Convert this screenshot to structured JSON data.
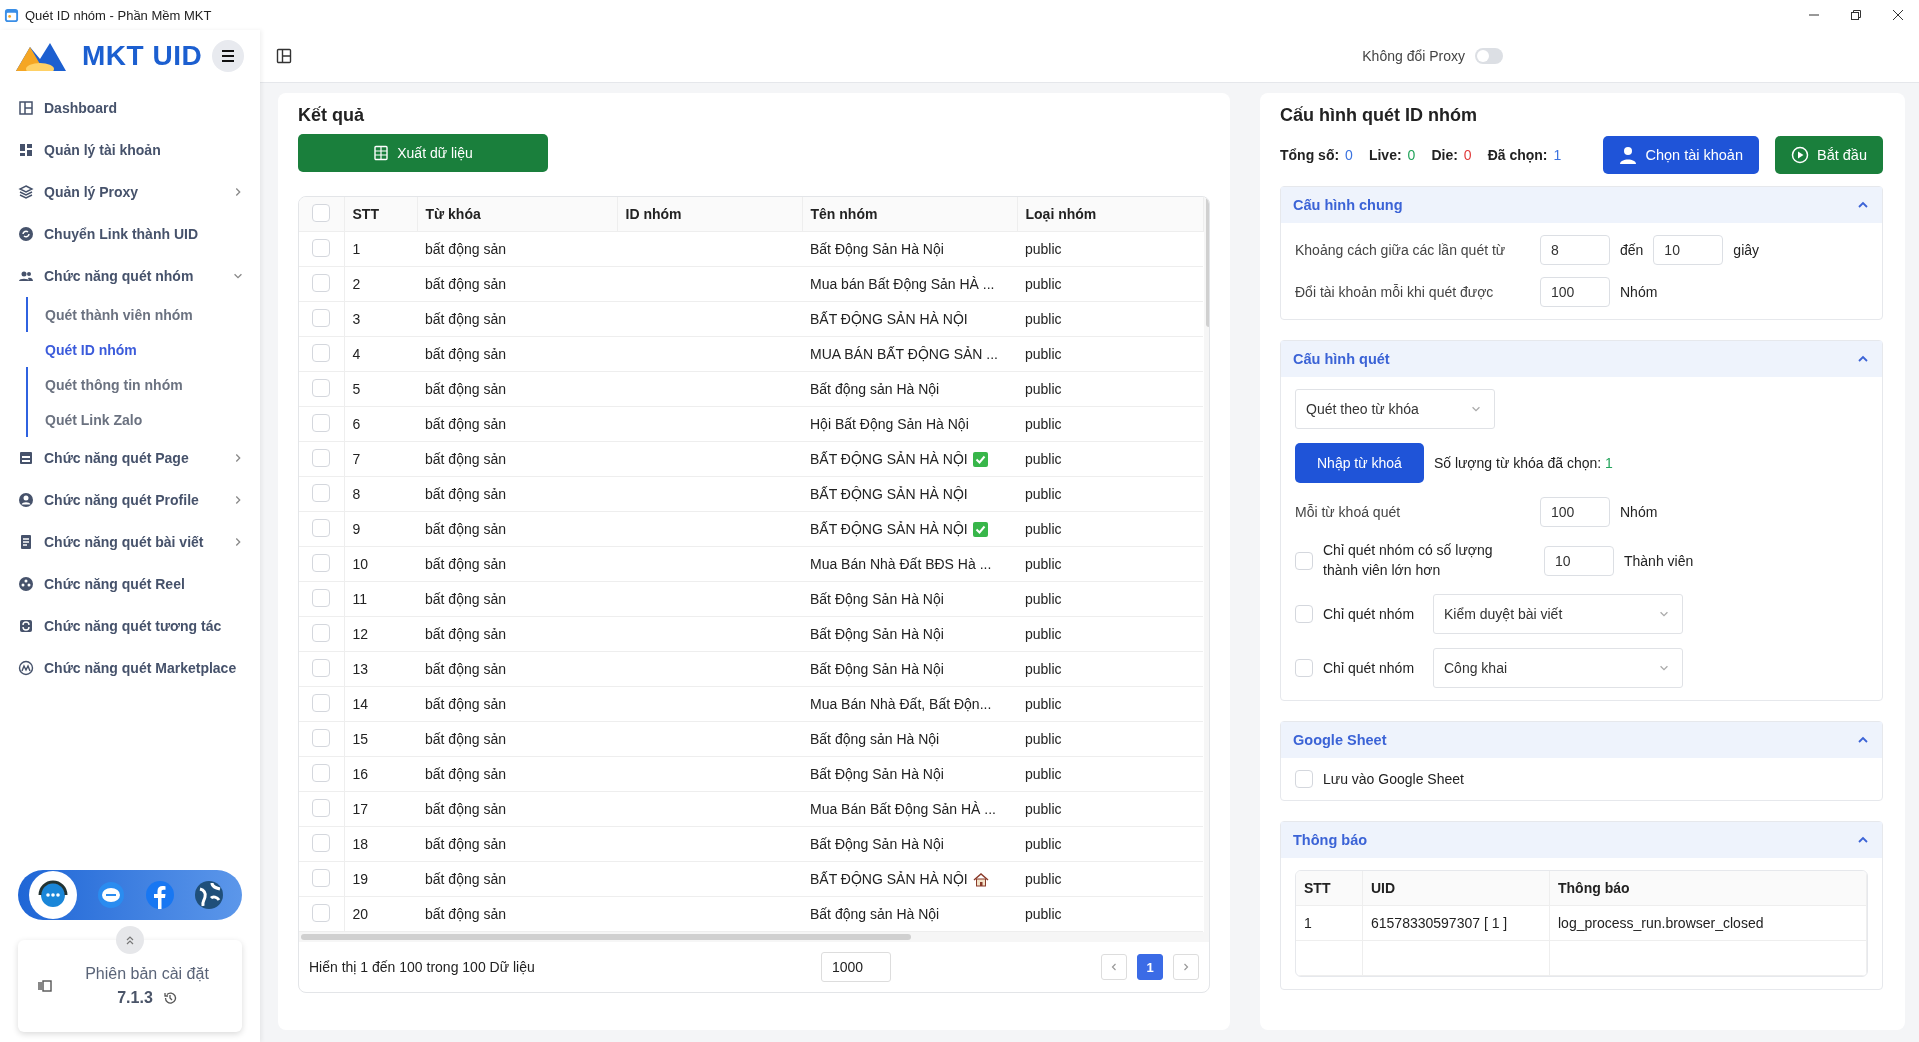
{
  "window": {
    "title": "Quét ID nhóm - Phần Mềm MKT"
  },
  "sidebar": {
    "logo": "MKT UID",
    "items": [
      {
        "kind": "link",
        "label": "Dashboard"
      },
      {
        "kind": "link",
        "label": "Quản lý tài khoản"
      },
      {
        "kind": "group",
        "label": "Quản lý Proxy",
        "expanded": false
      },
      {
        "kind": "link",
        "label": "Chuyển Link thành UID"
      },
      {
        "kind": "group",
        "label": "Chức năng quét nhóm",
        "expanded": true,
        "children": [
          {
            "label": "Quét thành viên nhóm",
            "selected": false
          },
          {
            "label": "Quét ID nhóm",
            "selected": true
          },
          {
            "label": "Quét thông tin nhóm",
            "selected": false
          },
          {
            "label": "Quét Link Zalo",
            "selected": false
          }
        ]
      },
      {
        "kind": "group",
        "label": "Chức năng quét Page",
        "expanded": false
      },
      {
        "kind": "group",
        "label": "Chức năng quét Profile",
        "expanded": false
      },
      {
        "kind": "group",
        "label": "Chức năng quét bài viết",
        "expanded": false
      },
      {
        "kind": "link",
        "label": "Chức năng quét Reel"
      },
      {
        "kind": "link",
        "label": "Chức năng quét tương tác"
      },
      {
        "kind": "link",
        "label": "Chức năng quét Marketplace"
      }
    ],
    "version": {
      "label": "Phiên bản cài đặt",
      "number": "7.1.3"
    }
  },
  "header": {
    "proxy_toggle": {
      "label": "Không đổi Proxy",
      "on": false
    }
  },
  "results": {
    "title": "Kết quả",
    "export_button": "Xuất dữ liệu",
    "table": {
      "all_checked": false,
      "columns": [
        "STT",
        "Từ khóa",
        "ID nhóm",
        "Tên nhóm",
        "Loại nhóm"
      ],
      "rows": [
        {
          "checked": false,
          "stt": "1",
          "keyword": "bất động sản",
          "name": "Bất Động Sản Hà Nội",
          "type": "public"
        },
        {
          "checked": false,
          "stt": "2",
          "keyword": "bất động sản",
          "name": "Mua bán Bất Động Sản HÀ ...",
          "type": "public"
        },
        {
          "checked": false,
          "stt": "3",
          "keyword": "bất động sản",
          "name": "BẤT ĐỘNG SẢN HÀ NỘI",
          "type": "public"
        },
        {
          "checked": false,
          "stt": "4",
          "keyword": "bất động sản",
          "name": "MUA BÁN BẤT ĐỘNG SẢN ...",
          "type": "public"
        },
        {
          "checked": false,
          "stt": "5",
          "keyword": "bất động sản",
          "name": "Bất động sản Hà Nội",
          "type": "public"
        },
        {
          "checked": false,
          "stt": "6",
          "keyword": "bất động sản",
          "name": "Hội Bất Động Sản Hà Nội",
          "type": "public"
        },
        {
          "checked": false,
          "stt": "7",
          "keyword": "bất động sản",
          "name": "BẤT ĐỘNG SẢN HÀ NỘI",
          "kind": "check",
          "type": "public"
        },
        {
          "checked": false,
          "stt": "8",
          "keyword": "bất động sản",
          "name": "BẤT ĐỘNG SẢN HÀ NỘI",
          "type": "public"
        },
        {
          "checked": false,
          "stt": "9",
          "keyword": "bất động sản",
          "name": "BẤT ĐỘNG SẢN HÀ NỘI",
          "kind": "check",
          "type": "public"
        },
        {
          "checked": false,
          "stt": "10",
          "keyword": "bất động sản",
          "name": "Mua Bán Nhà Đất BĐS Hà ...",
          "type": "public"
        },
        {
          "checked": false,
          "stt": "11",
          "keyword": "bất động sản",
          "name": "Bất Động Sản Hà Nội",
          "type": "public"
        },
        {
          "checked": false,
          "stt": "12",
          "keyword": "bất động sản",
          "name": "Bất Động Sản Hà Nội",
          "type": "public"
        },
        {
          "checked": false,
          "stt": "13",
          "keyword": "bất động sản",
          "name": "Bất Động Sản Hà Nội",
          "type": "public"
        },
        {
          "checked": false,
          "stt": "14",
          "keyword": "bất động sản",
          "name": "Mua Bán Nhà Đất, Bất Độn...",
          "type": "public"
        },
        {
          "checked": false,
          "stt": "15",
          "keyword": "bất động sản",
          "name": "Bất động sản Hà Nội",
          "type": "public"
        },
        {
          "checked": false,
          "stt": "16",
          "keyword": "bất động sản",
          "name": "Bất Động Sản Hà Nội",
          "type": "public"
        },
        {
          "checked": false,
          "stt": "17",
          "keyword": "bất động sản",
          "name": "Mua Bán Bất Động Sản HÀ ...",
          "type": "public"
        },
        {
          "checked": false,
          "stt": "18",
          "keyword": "bất động sản",
          "name": "Bất Động Sản Hà Nội",
          "type": "public"
        },
        {
          "checked": false,
          "stt": "19",
          "keyword": "bất động sản",
          "name": "BẤT ĐỘNG SẢN HÀ NỘI",
          "kind": "house",
          "type": "public"
        },
        {
          "checked": false,
          "stt": "20",
          "keyword": "bất động sản",
          "name": "Bất động sản Hà Nội",
          "type": "public"
        }
      ]
    },
    "footer": {
      "summary": "Hiển thị 1 đến 100 trong 100 Dữ liệu",
      "page_size": "1000",
      "pages": [
        {
          "label": "1",
          "selected": true
        }
      ]
    }
  },
  "config": {
    "title": "Cấu hình quét ID nhóm",
    "stats": [
      {
        "label": "Tổng số:",
        "value": "0",
        "color": "#3b73e0"
      },
      {
        "label": "Live:",
        "value": "0",
        "color": "#22a35a"
      },
      {
        "label": "Die:",
        "value": "0",
        "color": "#e03b3b"
      },
      {
        "label": "Đã chọn:",
        "value": "1",
        "color": "#3b73e0"
      }
    ],
    "choose_account_button": "Chọn tài khoản",
    "start_button": "Bắt đầu",
    "general": {
      "title": "Cấu hình chung",
      "expanded": true,
      "interval_label": "Khoảng cách giữa các lần quét từ",
      "from": "8",
      "to_label": "đến",
      "to": "10",
      "unit": "giây",
      "switch_label": "Đổi tài khoản mỗi khi quét được",
      "switch_value": "100",
      "switch_unit": "Nhóm"
    },
    "scan": {
      "title": "Cấu hình quét",
      "expanded": true,
      "mode": "Quét theo từ khóa",
      "import_button": "Nhập từ khoá",
      "count_label": "Số lượng từ khóa đã chọn:",
      "count": "1",
      "per_keyword_label": "Mỗi từ khoá quét",
      "per_keyword": "100",
      "per_keyword_unit": "Nhóm",
      "filters": [
        {
          "kind": "input",
          "checked": false,
          "label": "Chỉ quét nhóm có số lượng thành viên lớn hơn",
          "value": "10",
          "unit": "Thành viên"
        },
        {
          "kind": "select",
          "checked": false,
          "label": "Chỉ quét nhóm",
          "value": "Kiểm duyệt bài viết"
        },
        {
          "kind": "select",
          "checked": false,
          "label": "Chỉ quét nhóm",
          "value": "Công khai"
        }
      ]
    },
    "google_sheet": {
      "title": "Google Sheet",
      "expanded": true,
      "save": {
        "label": "Lưu vào Google Sheet",
        "checked": false
      }
    },
    "notifications": {
      "title": "Thông báo",
      "expanded": true,
      "columns": [
        "STT",
        "UID",
        "Thông báo"
      ],
      "rows": [
        [
          "1",
          "61578330597307 [ 1 ]",
          "log_process_run.browser_closed"
        ]
      ]
    }
  }
}
